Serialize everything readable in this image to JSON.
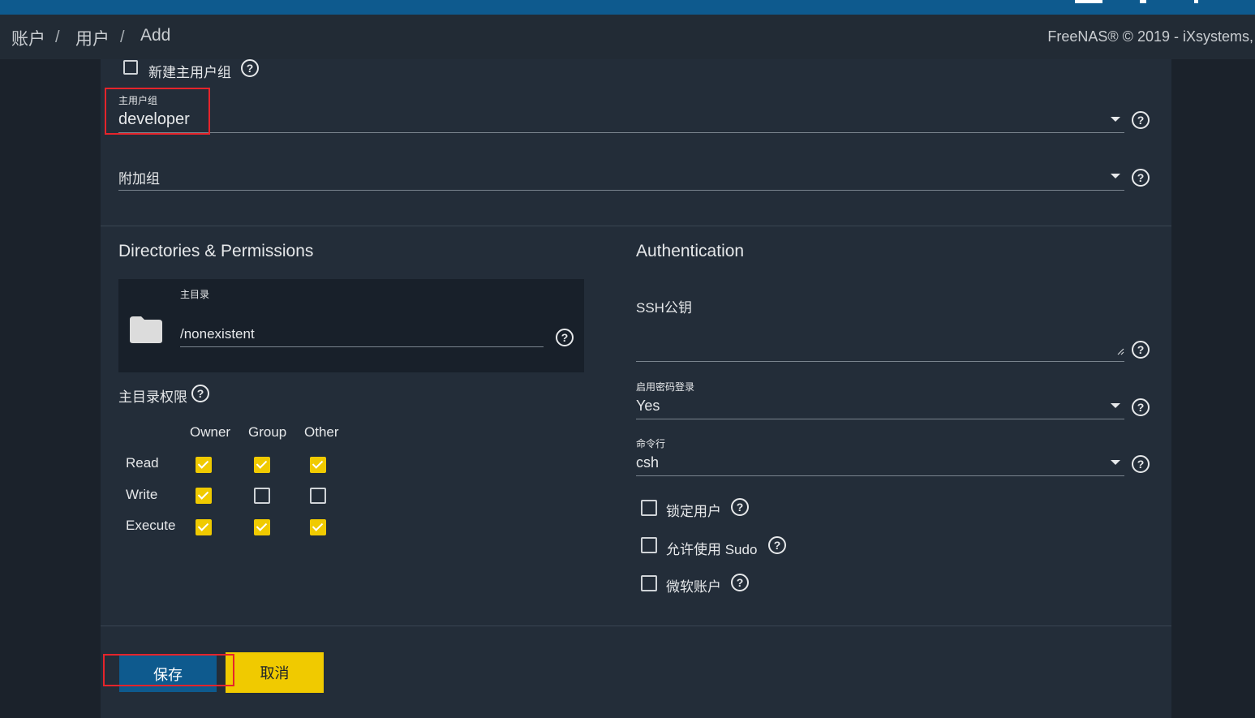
{
  "breadcrumb": {
    "item1": "账户",
    "sep": "/",
    "item2": "用户",
    "item3": "Add"
  },
  "copyright": "FreeNAS® © 2019 - iXsystems,",
  "group": {
    "new_primary_group_label": "新建主用户组",
    "new_primary_group_checked": false,
    "primary_group_label": "主用户组",
    "primary_group_value": "developer",
    "aux_groups_placeholder": "附加组"
  },
  "directories": {
    "title": "Directories & Permissions",
    "home_dir_label": "主目录",
    "home_dir_value": "/nonexistent",
    "perm_label": "主目录权限",
    "columns": [
      "Owner",
      "Group",
      "Other"
    ],
    "rows": [
      {
        "label": "Read",
        "values": [
          true,
          true,
          true
        ]
      },
      {
        "label": "Write",
        "values": [
          true,
          false,
          false
        ]
      },
      {
        "label": "Execute",
        "values": [
          true,
          true,
          true
        ]
      }
    ]
  },
  "auth": {
    "title": "Authentication",
    "ssh_label": "SSH公钥",
    "password_login_label": "启用密码登录",
    "password_login_value": "Yes",
    "shell_label": "命令行",
    "shell_value": "csh",
    "lock_user_label": "锁定用户",
    "sudo_label": "允许使用 Sudo",
    "microsoft_label": "微软账户"
  },
  "buttons": {
    "save": "保存",
    "cancel": "取消"
  },
  "colors": {
    "topbar": "#0e5a8e",
    "accent_yellow": "#f0ca00",
    "save_blue": "#0e5a8e",
    "highlight_red": "#e5242b"
  }
}
